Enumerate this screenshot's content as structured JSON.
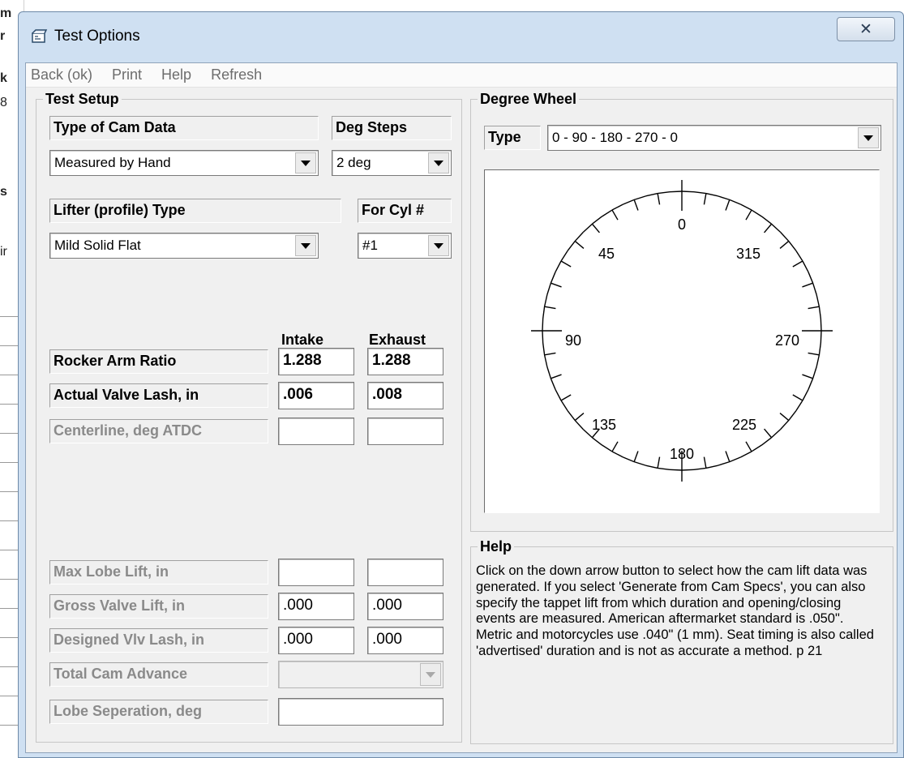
{
  "window": {
    "title": "Test Options",
    "close_glyph": "✕"
  },
  "menu": [
    "Back (ok)",
    "Print",
    "Help",
    "Refresh"
  ],
  "background": {
    "marks": [
      "m",
      "r",
      "k",
      "8",
      "s",
      "ir"
    ]
  },
  "test_setup": {
    "title": "Test Setup",
    "type_of_cam_data_label": "Type of Cam Data",
    "type_of_cam_data_value": "Measured by Hand",
    "deg_steps_label": "Deg Steps",
    "deg_steps_value": "2 deg",
    "lifter_type_label": "Lifter (profile) Type",
    "lifter_type_value": "Mild Solid Flat",
    "for_cyl_label": "For Cyl #",
    "for_cyl_value": "#1",
    "intake_header": "Intake",
    "exhaust_header": "Exhaust",
    "rows_top": [
      {
        "label": "Rocker Arm Ratio",
        "intake": "1.288",
        "exhaust": "1.288",
        "disabled": false
      },
      {
        "label": "Actual Valve Lash, in",
        "intake": ".006",
        "exhaust": ".008",
        "disabled": false
      },
      {
        "label": "Centerline, deg ATDC",
        "intake": "",
        "exhaust": "",
        "disabled": true
      }
    ],
    "rows_bottom": [
      {
        "label": "Max Lobe Lift, in",
        "intake": "",
        "exhaust": ""
      },
      {
        "label": "Gross Valve Lift, in",
        "intake": ".000",
        "exhaust": ".000"
      },
      {
        "label": "Designed Vlv Lash, in",
        "intake": ".000",
        "exhaust": ".000"
      }
    ],
    "total_cam_advance_label": "Total Cam Advance",
    "total_cam_advance_value": "",
    "lobe_separation_label": "Lobe Seperation, deg",
    "lobe_separation_value": ""
  },
  "degree_wheel": {
    "title": "Degree Wheel",
    "type_label": "Type",
    "type_value": "0 - 90 - 180 - 270 - 0",
    "labels": [
      "0",
      "45",
      "315",
      "90",
      "270",
      "135",
      "225",
      "180"
    ]
  },
  "help": {
    "title": "Help",
    "text": "Click on the down arrow button to select how the cam lift data was generated.  If you select 'Generate from Cam Specs', you can also specify the tappet lift from which duration and opening/closing events are measured.  American aftermarket standard is .050\".  Metric and motorcycles use .040\" (1 mm).  Seat timing is also called 'advertised' duration and is not as accurate a method.  p 21"
  }
}
